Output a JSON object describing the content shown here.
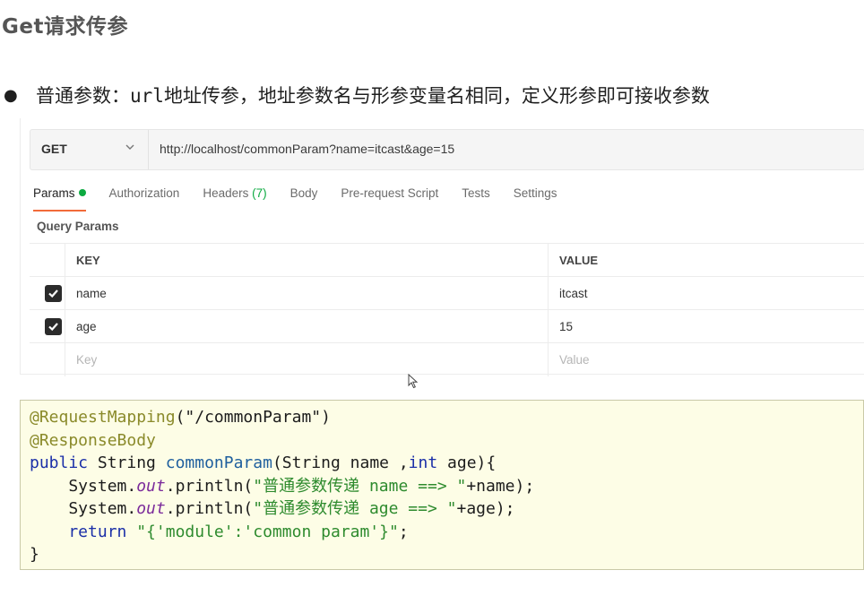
{
  "title": "Get请求传参",
  "bullet": {
    "prefix": "普通参数：",
    "mono": "url",
    "rest": "地址传参，地址参数名与形参变量名相同，定义形参即可接收参数"
  },
  "request": {
    "method": "GET",
    "url": "http://localhost/commonParam?name=itcast&age=15"
  },
  "tabs": [
    {
      "label": "Params",
      "active": true
    },
    {
      "label": "Authorization"
    },
    {
      "label": "Headers",
      "count": "(7)"
    },
    {
      "label": "Body"
    },
    {
      "label": "Pre-request Script"
    },
    {
      "label": "Tests"
    },
    {
      "label": "Settings"
    }
  ],
  "query_params_label": "Query Params",
  "table": {
    "headers": {
      "key": "KEY",
      "value": "VALUE"
    },
    "rows": [
      {
        "key": "name",
        "value": "itcast",
        "checked": true
      },
      {
        "key": "age",
        "value": "15",
        "checked": true
      }
    ],
    "placeholder": {
      "key": "Key",
      "value": "Value"
    }
  },
  "code": {
    "l1_ann": "@RequestMapping",
    "l1_rest": "(\"/commonParam\")",
    "l2_ann": "@ResponseBody",
    "l3_kw": "public",
    "l3_a": " String ",
    "l3_fn": "commonParam",
    "l3_b": "(String name ,",
    "l3_kw2": "int",
    "l3_c": " age){",
    "l4_a": "    System.",
    "l4_fld": "out",
    "l4_b": ".println(",
    "l4_str": "\"普通参数传递 name ==> \"",
    "l4_c": "+name);",
    "l5_a": "    System.",
    "l5_fld": "out",
    "l5_b": ".println(",
    "l5_str": "\"普通参数传递 age ==> \"",
    "l5_c": "+age);",
    "l6_kw": "    return",
    "l6_sp": " ",
    "l6_str": "\"{'module':'common param'}\"",
    "l6_c": ";",
    "l7": "}"
  },
  "colors": {
    "accent": "#f26b3a",
    "green": "#0caa41",
    "code_bg": "#fdfde6"
  }
}
